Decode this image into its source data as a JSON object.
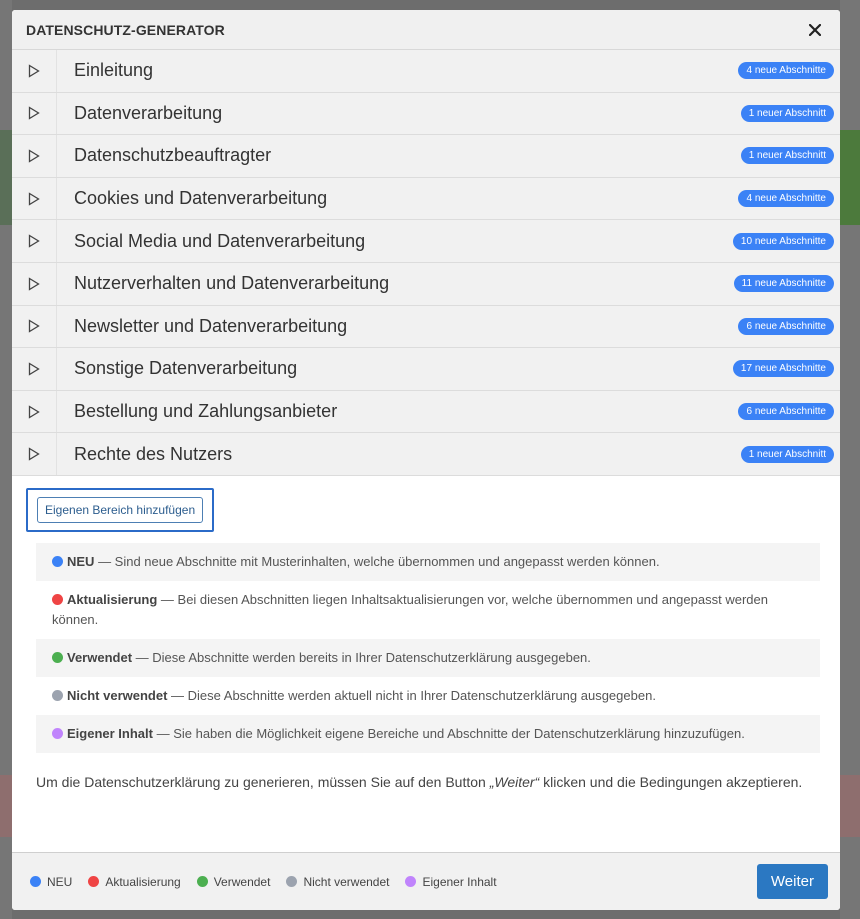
{
  "modal": {
    "title": "DATENSCHUTZ-GENERATOR"
  },
  "sections": [
    {
      "label": "Einleitung",
      "badge": "4 neue Abschnitte"
    },
    {
      "label": "Datenverarbeitung",
      "badge": "1 neuer Abschnitt"
    },
    {
      "label": "Datenschutzbeauftragter",
      "badge": "1 neuer Abschnitt"
    },
    {
      "label": "Cookies und Datenverarbeitung",
      "badge": "4 neue Abschnitte"
    },
    {
      "label": "Social Media und Datenverarbeitung",
      "badge": "10 neue Abschnitte"
    },
    {
      "label": "Nutzerverhalten und Datenverarbeitung",
      "badge": "11 neue Abschnitte"
    },
    {
      "label": "Newsletter und Datenverarbeitung",
      "badge": "6 neue Abschnitte"
    },
    {
      "label": "Sonstige Datenverarbeitung",
      "badge": "17 neue Abschnitte"
    },
    {
      "label": "Bestellung und Zahlungsanbieter",
      "badge": "6 neue Abschnitte"
    },
    {
      "label": "Rechte des Nutzers",
      "badge": "1 neuer Abschnitt"
    }
  ],
  "add_button": "Eigenen Bereich hinzufügen",
  "legend": [
    {
      "term": "NEU",
      "text": " — Sind neue Abschnitte mit Musterinhalten, welche übernommen und angepasst werden können.",
      "color": "#3b82f6"
    },
    {
      "term": "Aktualisierung",
      "text": " — Bei diesen Abschnitten liegen Inhaltsaktualisierungen vor, welche übernommen und angepasst werden können.",
      "color": "#ef4444"
    },
    {
      "term": "Verwendet",
      "text": " — Diese Abschnitte werden bereits in Ihrer Datenschutzerklärung ausgegeben.",
      "color": "#4caf50"
    },
    {
      "term": "Nicht verwendet",
      "text": " — Diese Abschnitte werden aktuell nicht in Ihrer Datenschutzerklärung ausgegeben.",
      "color": "#9ca3af"
    },
    {
      "term": "Eigener Inhalt",
      "text": " — Sie haben die Möglichkeit eigene Bereiche und Abschnitte der Datenschutzerklärung hinzuzufügen.",
      "color": "#c084fc"
    }
  ],
  "info": {
    "before": "Um die Datenschutzerklärung zu generieren, müssen Sie auf den Button ",
    "emph": "„Weiter“",
    "after": " klicken und die Bedingungen akzeptieren."
  },
  "footer": {
    "legend": [
      {
        "label": "NEU",
        "color": "#3b82f6"
      },
      {
        "label": "Aktualisierung",
        "color": "#ef4444"
      },
      {
        "label": "Verwendet",
        "color": "#4caf50"
      },
      {
        "label": "Nicht verwendet",
        "color": "#9ca3af"
      },
      {
        "label": "Eigener Inhalt",
        "color": "#c084fc"
      }
    ],
    "next_label": "Weiter"
  }
}
